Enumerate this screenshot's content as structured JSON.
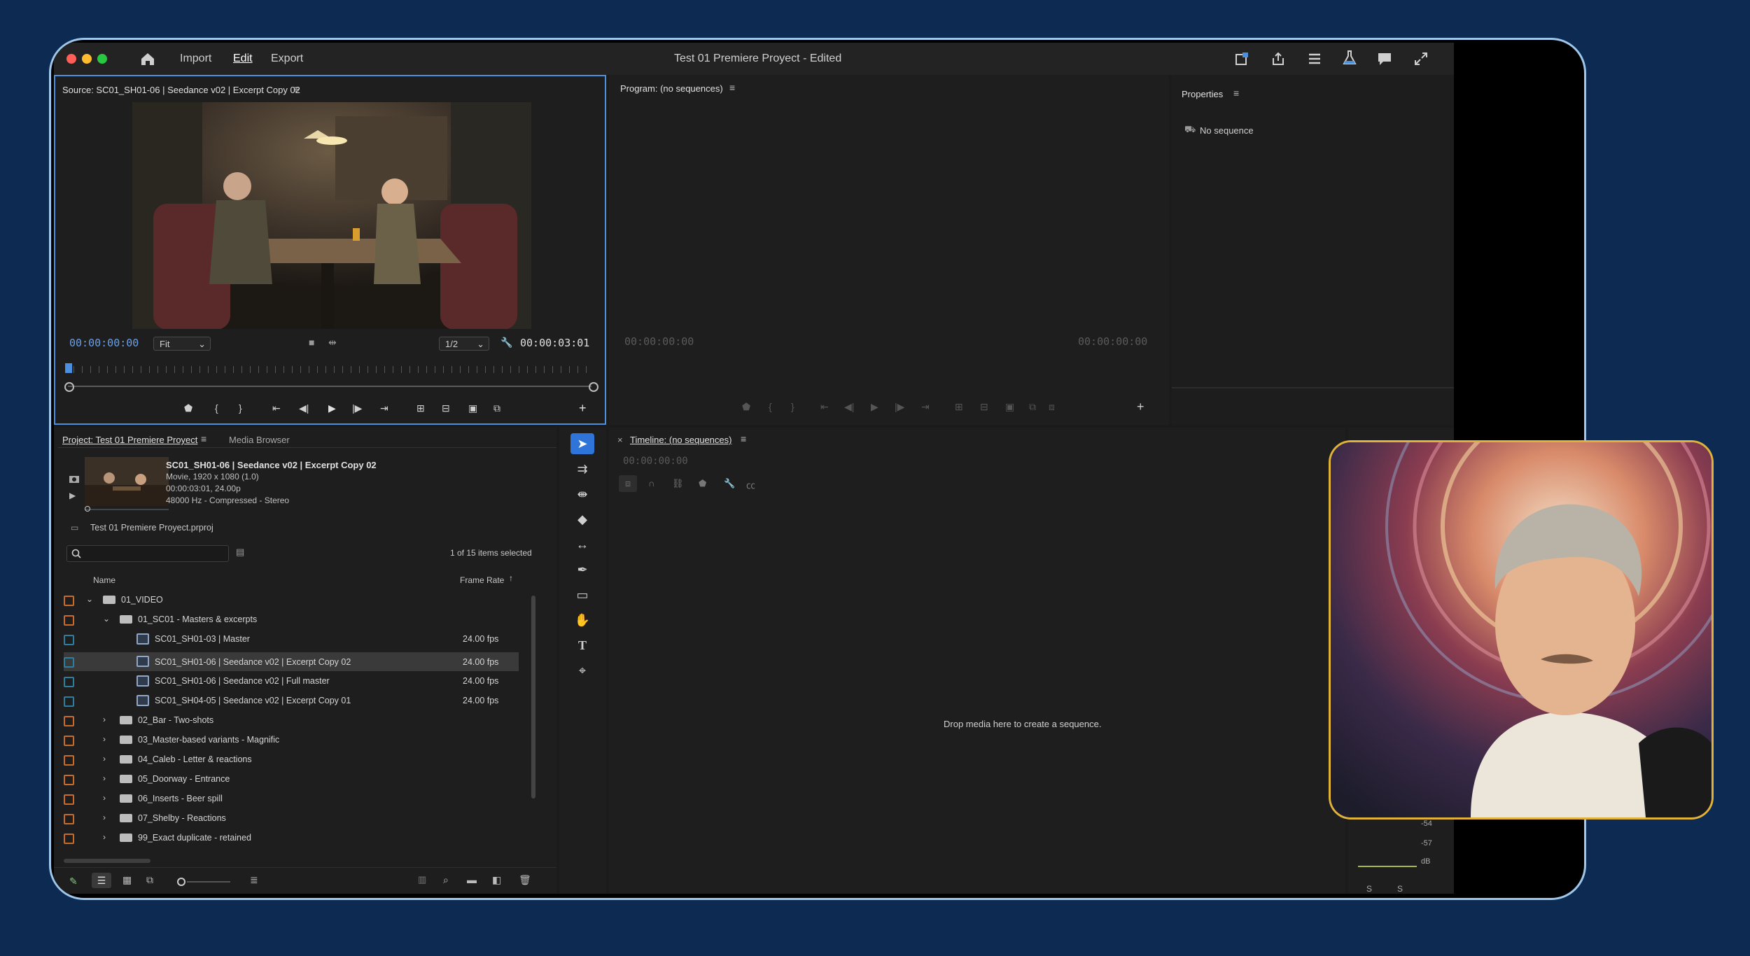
{
  "menubar": {
    "title": "Test 01 Premiere Proyect",
    "title_status": " - Edited",
    "items": [
      "Import",
      "Edit",
      "Export"
    ]
  },
  "source_monitor": {
    "title": "Source: SC01_SH01-06 | Seedance v02 | Excerpt Copy 02",
    "timecode_in": "00:00:00:00",
    "fit": "Fit",
    "resolution": "1/2",
    "duration": "00:00:03:01"
  },
  "program_monitor": {
    "title": "Program: (no sequences)",
    "timecode_left": "00:00:00:00",
    "timecode_right": "00:00:00:00"
  },
  "properties": {
    "title": "Properties",
    "status": "No sequence"
  },
  "project": {
    "tab_project": "Project: Test 01 Premiere Proyect",
    "tab_media": "Media Browser",
    "clip_name": "SC01_SH01-06 | Seedance v02 | Excerpt Copy 02",
    "clip_type": "Movie, 1920 x 1080 (1.0)",
    "clip_time": "00:00:03:01, 24.00p",
    "clip_audio": "48000 Hz - Compressed - Stereo",
    "file": "Test 01 Premiere Proyect.prproj",
    "search_placeholder": "",
    "selection": "1 of 15 items selected",
    "col_name": "Name",
    "col_framerate": "Frame Rate",
    "items": [
      {
        "label": "01_VIDEO",
        "fps": ""
      },
      {
        "label": "01_SC01 - Masters & excerpts",
        "fps": ""
      },
      {
        "label": "SC01_SH01-03 | Master",
        "fps": "24.00 fps"
      },
      {
        "label": "SC01_SH01-06 | Seedance v02 | Excerpt Copy 02",
        "fps": "24.00 fps"
      },
      {
        "label": "SC01_SH01-06 | Seedance v02 | Full master",
        "fps": "24.00 fps"
      },
      {
        "label": "SC01_SH04-05 | Seedance v02 | Excerpt Copy 01",
        "fps": "24.00 fps"
      },
      {
        "label": "02_Bar - Two-shots",
        "fps": ""
      },
      {
        "label": "03_Master-based variants - Magnific",
        "fps": ""
      },
      {
        "label": "04_Caleb - Letter & reactions",
        "fps": ""
      },
      {
        "label": "05_Doorway - Entrance",
        "fps": ""
      },
      {
        "label": "06_Inserts - Beer spill",
        "fps": ""
      },
      {
        "label": "07_Shelby - Reactions",
        "fps": ""
      },
      {
        "label": "99_Exact duplicate - retained",
        "fps": ""
      }
    ]
  },
  "timeline": {
    "title": "Timeline: (no sequences)",
    "close": "×",
    "timecode": "00:00:00:00",
    "drop_hint": "Drop media here to create a sequence."
  },
  "meter": {
    "ticks": [
      "-54",
      "-57",
      "dB"
    ],
    "solo_left": "S",
    "solo_right": "S"
  },
  "colors": {
    "selection": "#3a3a3a",
    "accent": "#4a8fe0",
    "webcam_border": "#e0b23a",
    "label_orange": "#c86a28",
    "label_teal": "#2a7f9e"
  }
}
